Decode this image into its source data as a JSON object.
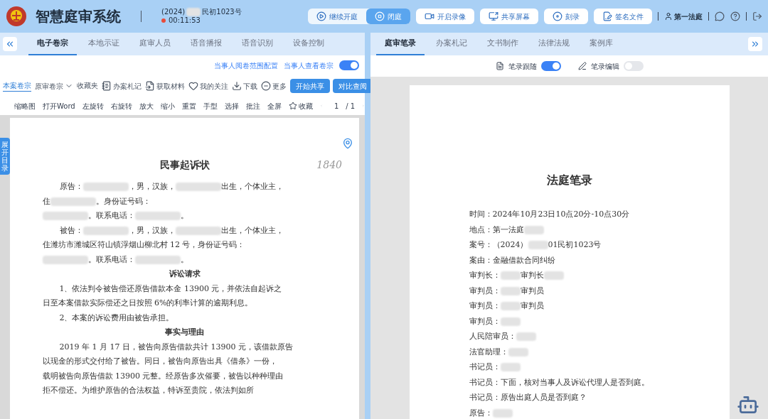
{
  "header": {
    "title": "智慧庭审系统",
    "case_prefix": "(2024)",
    "case_suffix": "民初1023号",
    "timer": "00:11:53",
    "recording": true,
    "controls": [
      {
        "label": "继续开庭",
        "kind": "play",
        "selected": false
      },
      {
        "label": "闭庭",
        "kind": "stop",
        "selected": true
      }
    ],
    "buttons": [
      {
        "label": "开启录像",
        "kind": "video"
      },
      {
        "label": "共享屏幕",
        "kind": "share"
      },
      {
        "label": "刻录",
        "kind": "disc"
      },
      {
        "label": "签名文件",
        "kind": "sign"
      }
    ],
    "court": "第一法庭"
  },
  "left": {
    "tabs": [
      {
        "label": "电子卷宗",
        "selected": true
      },
      {
        "label": "本地示证",
        "selected": false
      },
      {
        "label": "庭审人员",
        "selected": false
      },
      {
        "label": "语音播报",
        "selected": false
      },
      {
        "label": "语音识别",
        "selected": false
      },
      {
        "label": "设备控制",
        "selected": false
      }
    ],
    "config_link": "当事人阅卷范围配置",
    "view_toggle": {
      "label": "当事人查看卷宗",
      "on": true
    },
    "toolbar": [
      {
        "label": "本案卷宗",
        "kind": "tab",
        "selected": true
      },
      {
        "label": "原审卷宗",
        "kind": "dropdown",
        "selected": false
      },
      {
        "label": "收藏夹",
        "kind": "tab",
        "selected": false
      },
      {
        "label": "办案札记",
        "kind": "notes"
      },
      {
        "label": "获取材料",
        "kind": "fetch"
      },
      {
        "label": "我的关注",
        "kind": "heart"
      },
      {
        "label": "下载",
        "kind": "download"
      },
      {
        "label": "更多",
        "kind": "more"
      }
    ],
    "actions": [
      "开始共享",
      "对比查阅"
    ],
    "viewer_tools": [
      {
        "label": "缩略图"
      },
      {
        "label": "打开Word"
      },
      {
        "label": "左旋转"
      },
      {
        "label": "右旋转"
      },
      {
        "label": "放大"
      },
      {
        "label": "缩小"
      },
      {
        "label": "重置"
      },
      {
        "label": "手型"
      },
      {
        "label": "选择"
      },
      {
        "label": "批注"
      },
      {
        "label": "全屏"
      },
      {
        "label": "收藏",
        "kind": "star"
      }
    ],
    "page": "1",
    "pages": "/ 1",
    "outline_tab": "展开目录",
    "document": {
      "handwriting": "1840",
      "title": "民事起诉状",
      "lines": [
        {
          "kind": "indent",
          "parts": [
            {
              "text": "原告："
            },
            {
              "kind": "redacted"
            },
            {
              "text": "，男，汉族，"
            },
            {
              "kind": "redacted"
            },
            {
              "text": "出生，个体业主，"
            }
          ]
        },
        {
          "kind": "plain",
          "parts": [
            {
              "text": "住"
            },
            {
              "kind": "redacted"
            },
            {
              "text": "。身份证号码："
            }
          ]
        },
        {
          "kind": "plain",
          "parts": [
            {
              "kind": "redacted"
            },
            {
              "text": "。联系电话："
            },
            {
              "kind": "redacted"
            },
            {
              "text": "。"
            }
          ]
        },
        {
          "kind": "indent",
          "parts": [
            {
              "text": "被告："
            },
            {
              "kind": "redacted"
            },
            {
              "text": "，男，汉族，"
            },
            {
              "kind": "redacted"
            },
            {
              "text": "出生，个体业主，"
            }
          ]
        },
        {
          "kind": "plain",
          "parts": [
            {
              "text": "住潍坊市潍城区符山镇浮烟山柳北村 12 号，身份证号码："
            }
          ]
        },
        {
          "kind": "plain",
          "parts": [
            {
              "kind": "redacted"
            },
            {
              "text": "。联系电话："
            },
            {
              "kind": "redacted"
            },
            {
              "text": "。"
            }
          ]
        },
        {
          "kind": "heading",
          "parts": [
            {
              "text": "诉讼请求"
            }
          ]
        },
        {
          "kind": "indent",
          "parts": [
            {
              "text": "1、依法判令被告偿还原告借款本金 13900 元，并依法自起诉之"
            }
          ]
        },
        {
          "kind": "plain",
          "parts": [
            {
              "text": "日至本案借款实际偿还之日按照 6%的利率计算的逾期利息。"
            }
          ]
        },
        {
          "kind": "indent",
          "parts": [
            {
              "text": "2、本案的诉讼费用由被告承担。"
            }
          ]
        },
        {
          "kind": "heading",
          "parts": [
            {
              "text": "事实与理由"
            }
          ]
        },
        {
          "kind": "indent",
          "parts": [
            {
              "text": "2019 年 1 月 17 日，被告向原告借款共计 13900 元，该借款原告"
            }
          ]
        },
        {
          "kind": "plain",
          "parts": [
            {
              "text": "以现金的形式交付给了被告。同日，被告向原告出具《借条》一份，"
            }
          ]
        },
        {
          "kind": "plain",
          "parts": [
            {
              "text": "载明被告向原告借款 13900 元整。经原告多次催要，被告以种种理由"
            }
          ]
        },
        {
          "kind": "plain",
          "parts": [
            {
              "text": "拒不偿还。为维护原告的合法权益，特诉至贵院，依法判如所"
            }
          ]
        }
      ]
    }
  },
  "right": {
    "tabs": [
      {
        "label": "庭审笔录",
        "selected": true
      },
      {
        "label": "办案札记",
        "selected": false
      },
      {
        "label": "文书制作",
        "selected": false
      },
      {
        "label": "法律法规",
        "selected": false
      },
      {
        "label": "案例库",
        "selected": false
      }
    ],
    "toggles": [
      {
        "label": "笔录跟随",
        "on": true
      },
      {
        "label": "笔录编辑",
        "on": false
      }
    ],
    "record": {
      "title": "法庭笔录",
      "lines": [
        {
          "parts": [
            {
              "text": "时间：2024年10月23日10点20分-10点30分"
            }
          ]
        },
        {
          "parts": [
            {
              "text": "地点：第一法庭"
            },
            {
              "kind": "redacted"
            }
          ]
        },
        {
          "parts": [
            {
              "text": "案号：（2024）"
            },
            {
              "kind": "redacted"
            },
            {
              "text": "01民初1023号"
            }
          ]
        },
        {
          "parts": [
            {
              "text": "案由：金融借款合同纠纷"
            }
          ]
        },
        {
          "parts": [
            {
              "text": "审判长："
            },
            {
              "kind": "redacted"
            },
            {
              "text": "审判长"
            },
            {
              "kind": "redacted"
            }
          ]
        },
        {
          "parts": [
            {
              "text": "审判员："
            },
            {
              "kind": "redacted"
            },
            {
              "text": "审判员"
            }
          ]
        },
        {
          "parts": [
            {
              "text": "审判员："
            },
            {
              "kind": "redacted"
            },
            {
              "text": "审判员"
            }
          ]
        },
        {
          "parts": [
            {
              "text": "审判员："
            },
            {
              "kind": "redacted"
            }
          ]
        },
        {
          "parts": [
            {
              "text": "人民陪审员："
            },
            {
              "kind": "redacted"
            }
          ]
        },
        {
          "parts": [
            {
              "text": "法官助理："
            },
            {
              "kind": "redacted"
            }
          ]
        },
        {
          "parts": [
            {
              "text": "书记员："
            },
            {
              "kind": "redacted"
            }
          ]
        },
        {
          "parts": [
            {
              "text": "书记员：下面，核对当事人及诉讼代理人是否到庭。"
            }
          ]
        },
        {
          "parts": [
            {
              "text": "书记员：原告出庭人员是否到庭？"
            }
          ]
        },
        {
          "parts": [
            {
              "text": "原告："
            },
            {
              "kind": "redacted"
            }
          ]
        }
      ]
    }
  }
}
